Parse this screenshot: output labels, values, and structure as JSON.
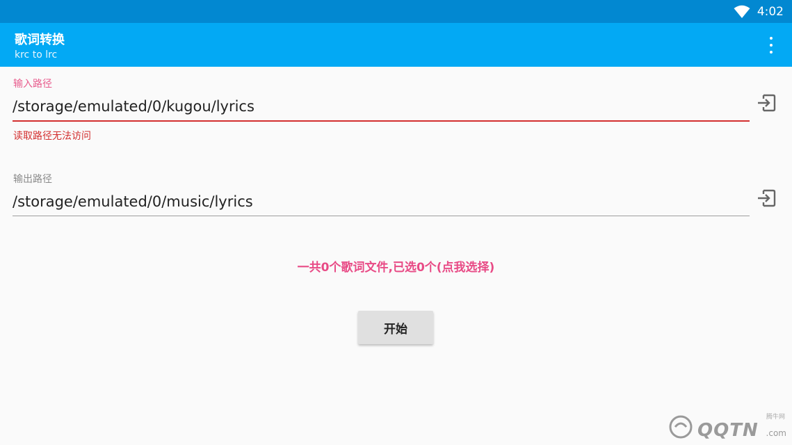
{
  "status_bar": {
    "time": "4:02",
    "wifi_icon": "wifi-icon"
  },
  "app_bar": {
    "title": "歌词转换",
    "subtitle": "krc to lrc",
    "overflow_icon": "more-vert-icon"
  },
  "input": {
    "label": "输入路径",
    "value": "/storage/emulated/0/kugou/lyrics",
    "error": "读取路径无法访问",
    "picker_icon": "folder-open-icon"
  },
  "output": {
    "label": "输出路径",
    "value": "/storage/emulated/0/music/lyrics",
    "picker_icon": "folder-open-icon"
  },
  "summary": "一共0个歌词文件,已选0个(点我选择)",
  "start_button": "开始",
  "watermark": {
    "text": "QQTN",
    "suffix": ".com",
    "cn": "腾牛网"
  },
  "colors": {
    "status_bar": "#0288d1",
    "app_bar": "#03a9f4",
    "accent": "#e84b86",
    "error": "#d32f2f",
    "background": "#fafafa"
  }
}
